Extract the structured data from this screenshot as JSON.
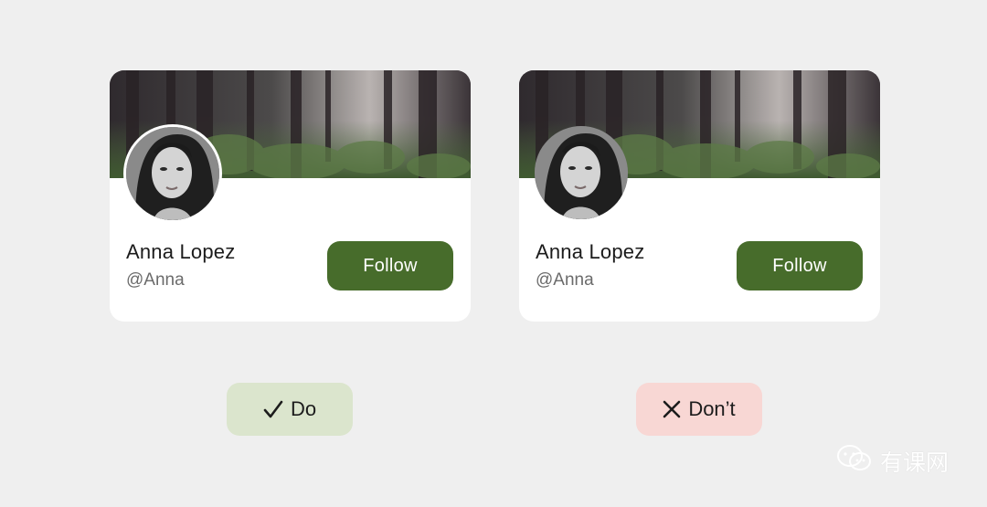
{
  "cards": [
    {
      "name": "Anna Lopez",
      "handle": "@Anna",
      "follow_label": "Follow"
    },
    {
      "name": "Anna Lopez",
      "handle": "@Anna",
      "follow_label": "Follow"
    }
  ],
  "badges": {
    "do": {
      "icon": "check-icon",
      "label": "Do"
    },
    "dont": {
      "icon": "close-icon",
      "label": "Don’t"
    }
  },
  "watermark": {
    "icon": "wechat-icon",
    "text": "有课网"
  },
  "colors": {
    "page_background": "#efefef",
    "card_background": "#ffffff",
    "follow_button": "#476c2b",
    "do_badge": "#dbe5cd",
    "dont_badge": "#f8d7d4"
  }
}
